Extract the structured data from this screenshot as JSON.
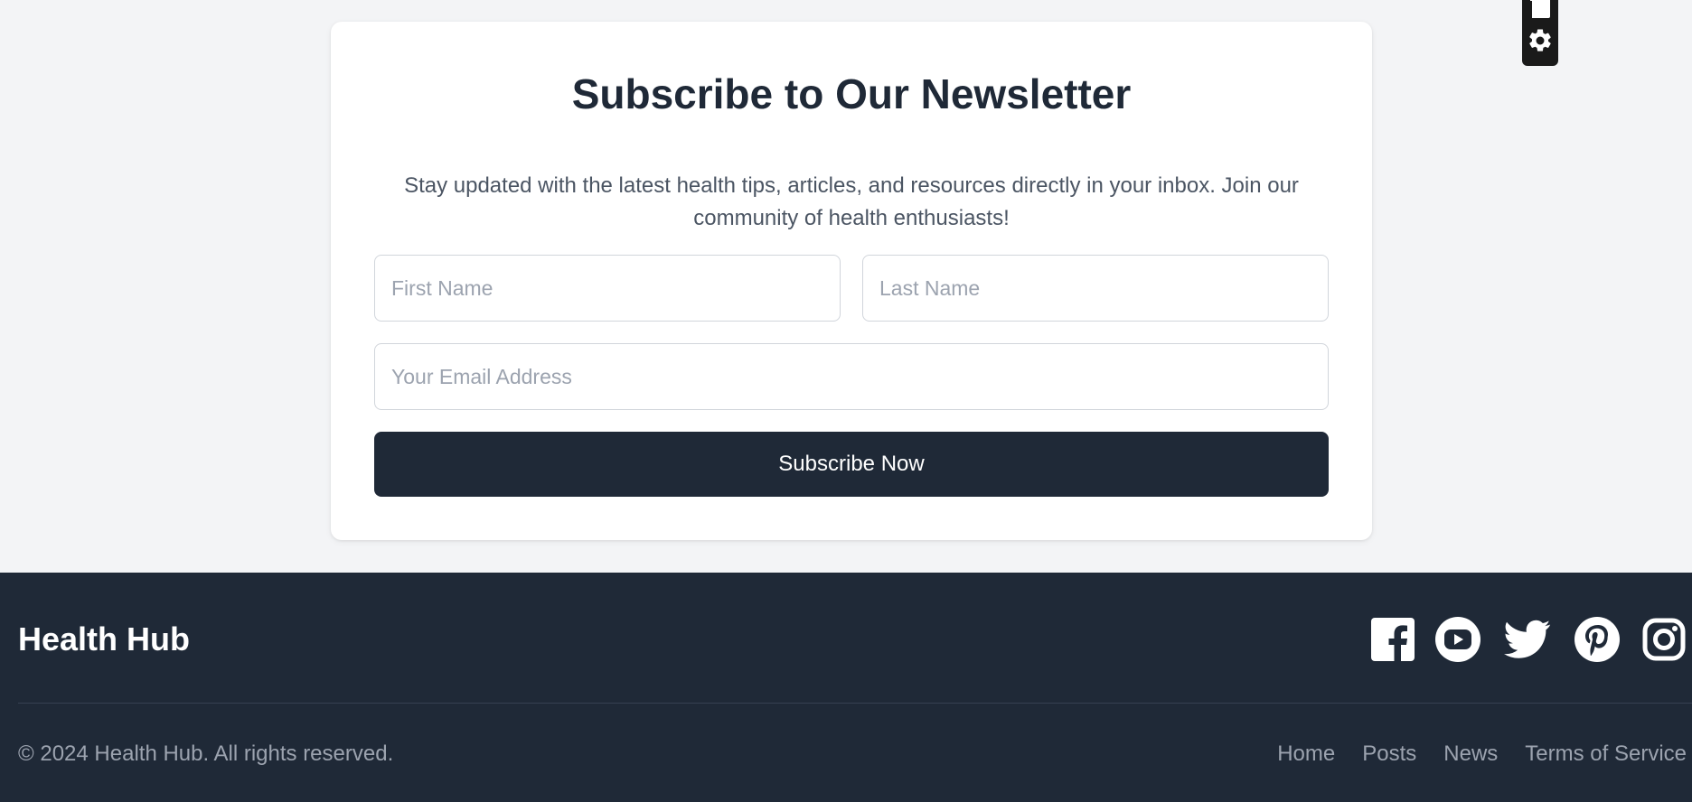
{
  "newsletter": {
    "title": "Subscribe to Our Newsletter",
    "description": "Stay updated with the latest health tips, articles, and resources directly in your inbox. Join our community of health enthusiasts!",
    "first_name_placeholder": "First Name",
    "last_name_placeholder": "Last Name",
    "email_placeholder": "Your Email Address",
    "submit_label": "Subscribe Now"
  },
  "widget": {
    "icons": [
      "tab-icon",
      "gear-icon"
    ]
  },
  "footer": {
    "brand": "Health Hub",
    "social_icons": [
      "facebook-icon",
      "youtube-icon",
      "twitter-icon",
      "pinterest-icon",
      "instagram-icon"
    ],
    "copyright": "© 2024 Health Hub. All rights reserved.",
    "links": [
      "Home",
      "Posts",
      "News",
      "Terms of Service"
    ]
  },
  "colors": {
    "page_background": "#f3f4f6",
    "card_background": "#ffffff",
    "primary_dark": "#1f2937",
    "muted_text": "#9ca3af",
    "body_text": "#4b5563"
  }
}
